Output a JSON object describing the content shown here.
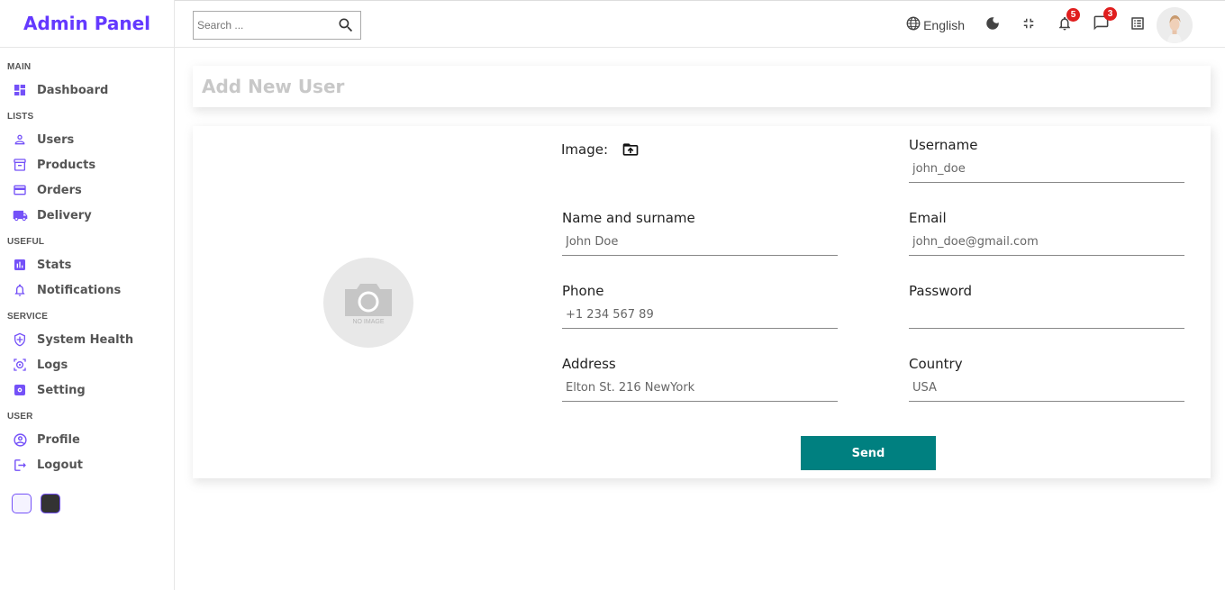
{
  "brand": {
    "title": "Admin Panel",
    "color": "#6439ff"
  },
  "sidebar": {
    "sections": [
      {
        "title": "MAIN",
        "items": [
          {
            "label": "Dashboard",
            "icon": "dashboard-icon"
          }
        ]
      },
      {
        "title": "LISTS",
        "items": [
          {
            "label": "Users",
            "icon": "person-icon"
          },
          {
            "label": "Products",
            "icon": "store-icon"
          },
          {
            "label": "Orders",
            "icon": "credit-card-icon"
          },
          {
            "label": "Delivery",
            "icon": "truck-icon"
          }
        ]
      },
      {
        "title": "USEFUL",
        "items": [
          {
            "label": "Stats",
            "icon": "bar-chart-icon"
          },
          {
            "label": "Notifications",
            "icon": "bell-icon"
          }
        ]
      },
      {
        "title": "SERVICE",
        "items": [
          {
            "label": "System Health",
            "icon": "shield-icon"
          },
          {
            "label": "Logs",
            "icon": "psychology-icon"
          },
          {
            "label": "Setting",
            "icon": "settings-icon"
          }
        ]
      },
      {
        "title": "USER",
        "items": [
          {
            "label": "Profile",
            "icon": "account-circle-icon"
          },
          {
            "label": "Logout",
            "icon": "logout-icon"
          }
        ]
      }
    ],
    "accent": "#7451f8"
  },
  "topbar": {
    "search_placeholder": "Search ...",
    "language": "English",
    "notifications_count": "5",
    "messages_count": "3"
  },
  "page": {
    "title": "Add New User",
    "image_label": "Image:",
    "photo_placeholder": "NO IMAGE",
    "send_label": "Send",
    "send_color": "#008080",
    "fields": {
      "username": {
        "label": "Username",
        "placeholder": "john_doe"
      },
      "name": {
        "label": "Name and surname",
        "placeholder": "John Doe"
      },
      "email": {
        "label": "Email",
        "placeholder": "john_doe@gmail.com"
      },
      "phone": {
        "label": "Phone",
        "placeholder": "+1 234 567 89"
      },
      "password": {
        "label": "Password",
        "placeholder": ""
      },
      "address": {
        "label": "Address",
        "placeholder": "Elton St. 216 NewYork"
      },
      "country": {
        "label": "Country",
        "placeholder": "USA"
      }
    }
  }
}
